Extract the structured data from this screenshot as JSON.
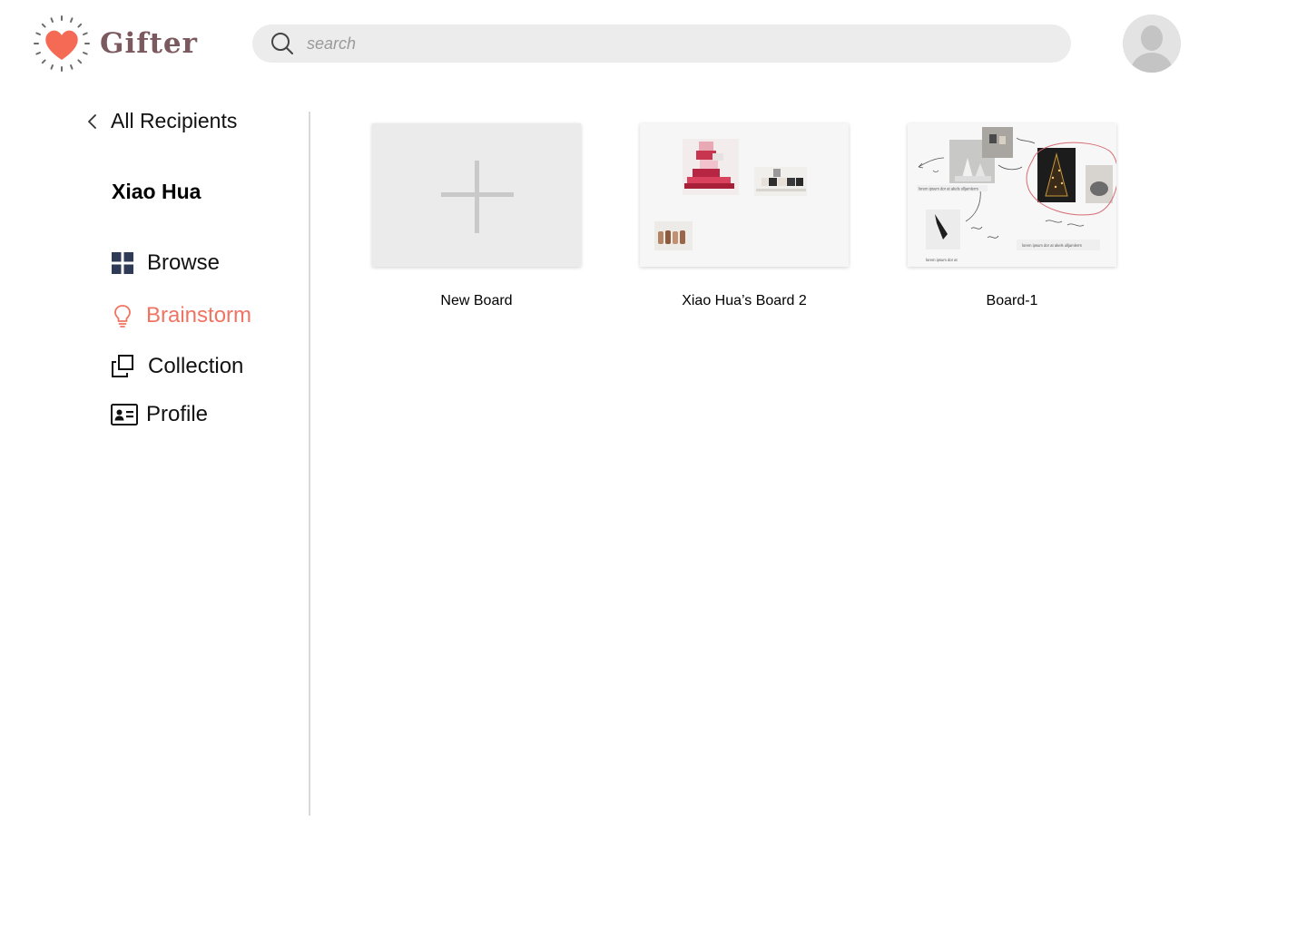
{
  "app": {
    "name": "Gifter",
    "brand_color": "#7b5a5f",
    "accent_color": "#f07462"
  },
  "header": {
    "search": {
      "placeholder": "search",
      "icon": "search-icon"
    },
    "avatar": {
      "icon": "user-avatar-icon"
    }
  },
  "sidebar": {
    "back_label": "All Recipients",
    "recipient_name": "Xiao Hua",
    "items": [
      {
        "label": "Browse",
        "icon": "grid-icon",
        "active": false
      },
      {
        "label": "Brainstorm",
        "icon": "lightbulb-icon",
        "active": true
      },
      {
        "label": "Collection",
        "icon": "layers-icon",
        "active": false
      },
      {
        "label": "Profile",
        "icon": "id-card-icon",
        "active": false
      }
    ]
  },
  "boards": [
    {
      "title": "New Board",
      "icon": "plus-icon"
    },
    {
      "title": "Xiao Hua’s Board 2"
    },
    {
      "title": "Board-1",
      "captions": [
        "lorem ipsum dor at akels ulljamlerrs",
        "lorem ipsum dor at akels ulljamlerrs",
        "lorem ipsum dor at"
      ]
    }
  ]
}
